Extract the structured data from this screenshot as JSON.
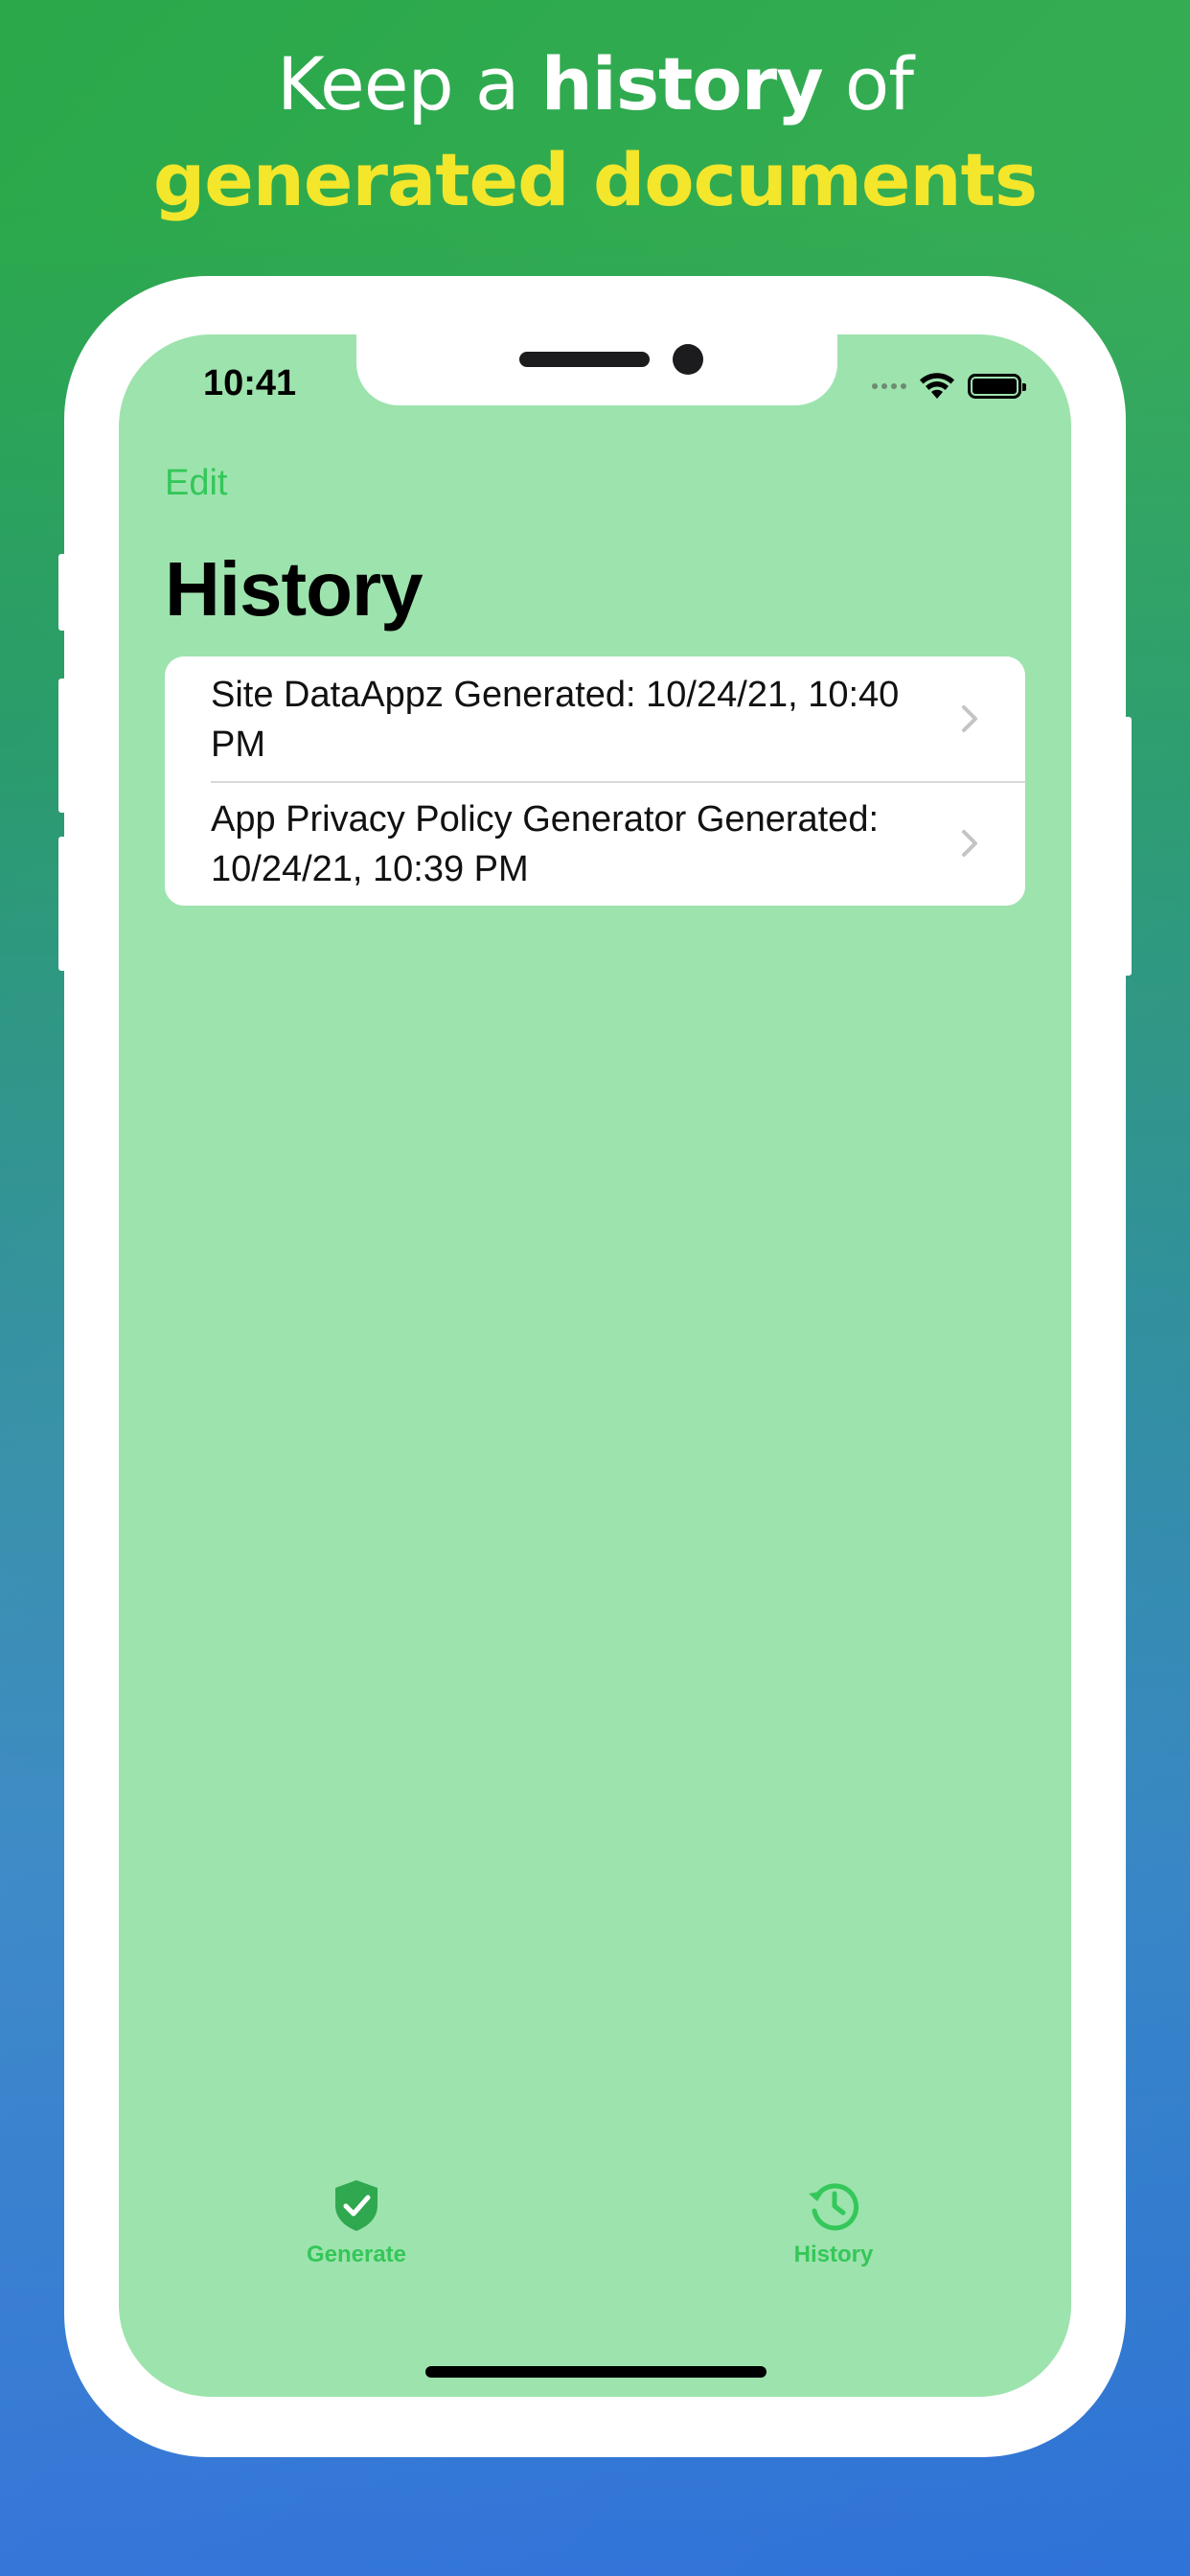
{
  "headline": {
    "line1_pre": "Keep a ",
    "line1_bold": "history",
    "line1_post": " of",
    "line2": "generated documents"
  },
  "status_bar": {
    "time": "10:41"
  },
  "nav": {
    "edit_label": "Edit",
    "title": "History"
  },
  "history": {
    "items": [
      {
        "label": "Site DataAppz Generated: 10/24/21, 10:40 PM"
      },
      {
        "label": "App Privacy Policy Generator Generated: 10/24/21, 10:39 PM"
      }
    ]
  },
  "tabbar": {
    "tabs": [
      {
        "label": "Generate",
        "icon": "shield-check-icon"
      },
      {
        "label": "History",
        "icon": "clock-history-icon"
      }
    ],
    "selected": "History"
  },
  "colors": {
    "accent": "#34c759",
    "screen_bg": "#9de3ad",
    "headline_highlight": "#f3e62b"
  }
}
